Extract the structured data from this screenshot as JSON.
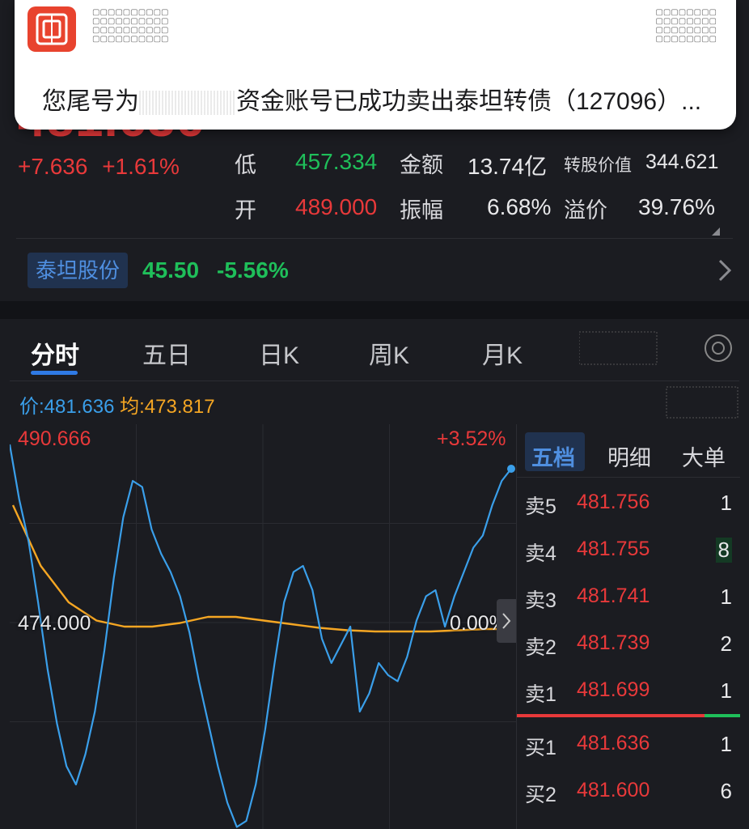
{
  "quote": {
    "price": "481.636",
    "change": "+7.636",
    "change_pct": "+1.61%",
    "low_label": "低",
    "low_value": "457.334",
    "amount_label": "金额",
    "amount_value": "13.74亿",
    "conv_value_label": "转股价值",
    "conv_value": "344.621",
    "open_label": "开",
    "open_value": "489.000",
    "amplitude_label": "振幅",
    "amplitude_value": "6.68%",
    "premium_label": "溢价",
    "premium_value": "39.76%"
  },
  "stock": {
    "name": "泰坦股份",
    "price": "45.50",
    "change_pct": "-5.56%"
  },
  "notification": {
    "text_prefix": "您尾号为",
    "text_suffix": "资金账号已成功卖出泰坦转债（127096）..."
  },
  "tabs": [
    "分时",
    "五日",
    "日K",
    "周K",
    "月K"
  ],
  "info": {
    "price_label": "价:",
    "price": "481.636",
    "avg_label": "均:",
    "avg": "473.817"
  },
  "plot": {
    "max_label": "490.666",
    "max_pct": "+3.52%",
    "base_label": "474.000",
    "base_pct": "0.00%"
  },
  "order_book": {
    "tabs": [
      "五档",
      "明细",
      "大单"
    ],
    "asks": [
      {
        "label": "卖5",
        "price": "481.756",
        "volume": "1"
      },
      {
        "label": "卖4",
        "price": "481.755",
        "volume": "8"
      },
      {
        "label": "卖3",
        "price": "481.741",
        "volume": "1"
      },
      {
        "label": "卖2",
        "price": "481.739",
        "volume": "2"
      },
      {
        "label": "卖1",
        "price": "481.699",
        "volume": "1"
      }
    ],
    "bids": [
      {
        "label": "买1",
        "price": "481.636",
        "volume": "1"
      },
      {
        "label": "买2",
        "price": "481.600",
        "volume": "6"
      }
    ]
  },
  "colors": {
    "up": "#e8393a",
    "down": "#1fbf5a",
    "price_line": "#3a9fea",
    "avg_line": "#f5a623",
    "accent": "#2f7ae5"
  },
  "chart_data": {
    "type": "line",
    "title": "",
    "series": [
      {
        "name": "价",
        "values": [
          489.0,
          484.5,
          481.0,
          476.0,
          470.5,
          466.0,
          462.5,
          461.0,
          463.5,
          467.0,
          472.0,
          478.0,
          483.0,
          486.0,
          485.5,
          482.0,
          480.0,
          478.5,
          476.5,
          473.5,
          469.5,
          466.0,
          462.5,
          459.5,
          457.5,
          458.0,
          461.0,
          465.5,
          471.0,
          476.0,
          478.5,
          479.0,
          477.0,
          473.0,
          471.0,
          472.5,
          474.0,
          467.0,
          468.5,
          471.0,
          470.0,
          469.5,
          471.5,
          474.5,
          476.5,
          477.0,
          474.0,
          476.5,
          478.5,
          480.5,
          481.5,
          484.0,
          486.0,
          487.0
        ]
      },
      {
        "name": "均",
        "values": [
          484.0,
          479.0,
          476.0,
          474.5,
          474.0,
          474.0,
          474.3,
          474.8,
          474.8,
          474.5,
          474.2,
          473.9,
          473.7,
          473.6,
          473.6,
          473.6,
          473.7,
          473.8,
          473.8
        ]
      }
    ],
    "ylim": [
      457.334,
      490.666
    ],
    "base": 474.0
  }
}
